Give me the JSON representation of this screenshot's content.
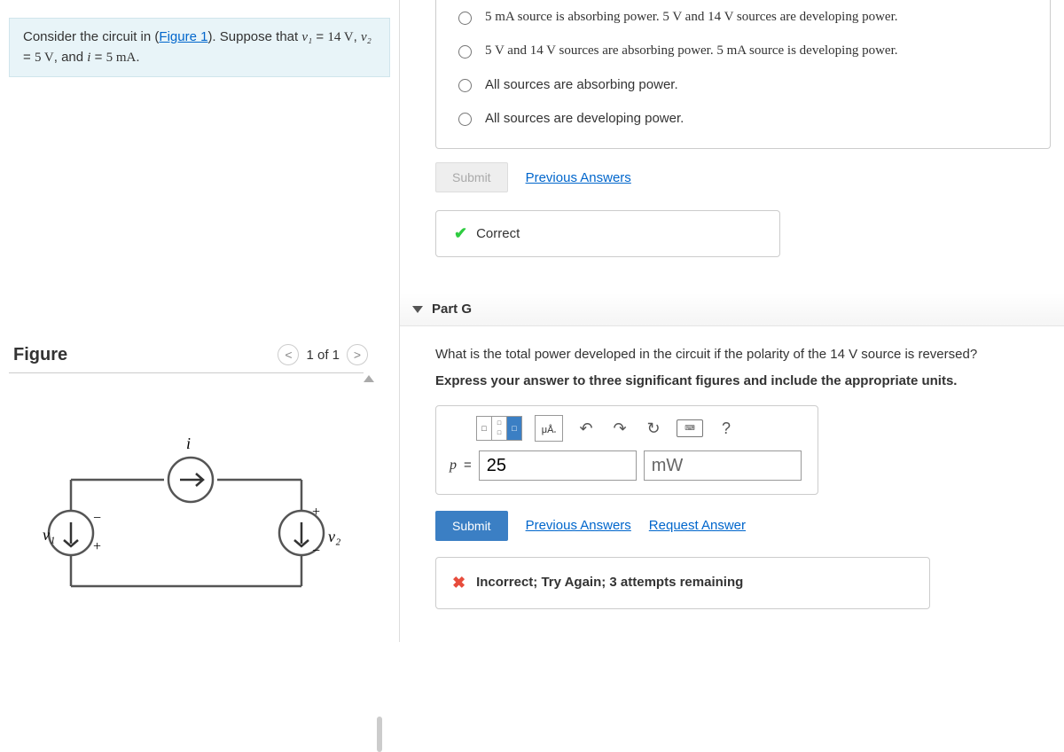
{
  "problem": {
    "prefix": "Consider the circuit in (",
    "figure_link": "Figure 1",
    "suffix1": "). Suppose that ",
    "v1_var": "v₁",
    "eq": " = ",
    "v1_val": "14 V",
    "sep1": ", ",
    "v2_var": "v₂",
    "v2_val": "5 V",
    "sep2": ", and ",
    "i_var": "i",
    "i_val": "5 mA",
    "end": "."
  },
  "figure": {
    "title": "Figure",
    "nav_text": "1 of 1",
    "labels": {
      "i": "i",
      "v1": "v₁",
      "v2": "v₂",
      "plus": "+",
      "minus": "−"
    }
  },
  "partF_options": [
    "5 mA source is absorbing power. 5 V and 14 V sources are developing power.",
    "5 V and 14 V sources are absorbing power. 5 mA source is developing power.",
    "All sources are absorbing power.",
    "All sources are developing power."
  ],
  "buttons": {
    "submit_disabled": "Submit",
    "submit_active": "Submit",
    "prev_answers": "Previous Answers",
    "request_answer": "Request Answer"
  },
  "feedback_correct": "Correct",
  "partG": {
    "title": "Part G",
    "question": "What is the total power developed in the circuit if the polarity of the 14 V source is reversed?",
    "instruction": "Express your answer to three significant figures and include the appropriate units.",
    "var_label": "p",
    "value": "25",
    "unit": "mW",
    "help": "?",
    "xa_label": "μÅ"
  },
  "feedback_incorrect": "Incorrect; Try Again; 3 attempts remaining"
}
